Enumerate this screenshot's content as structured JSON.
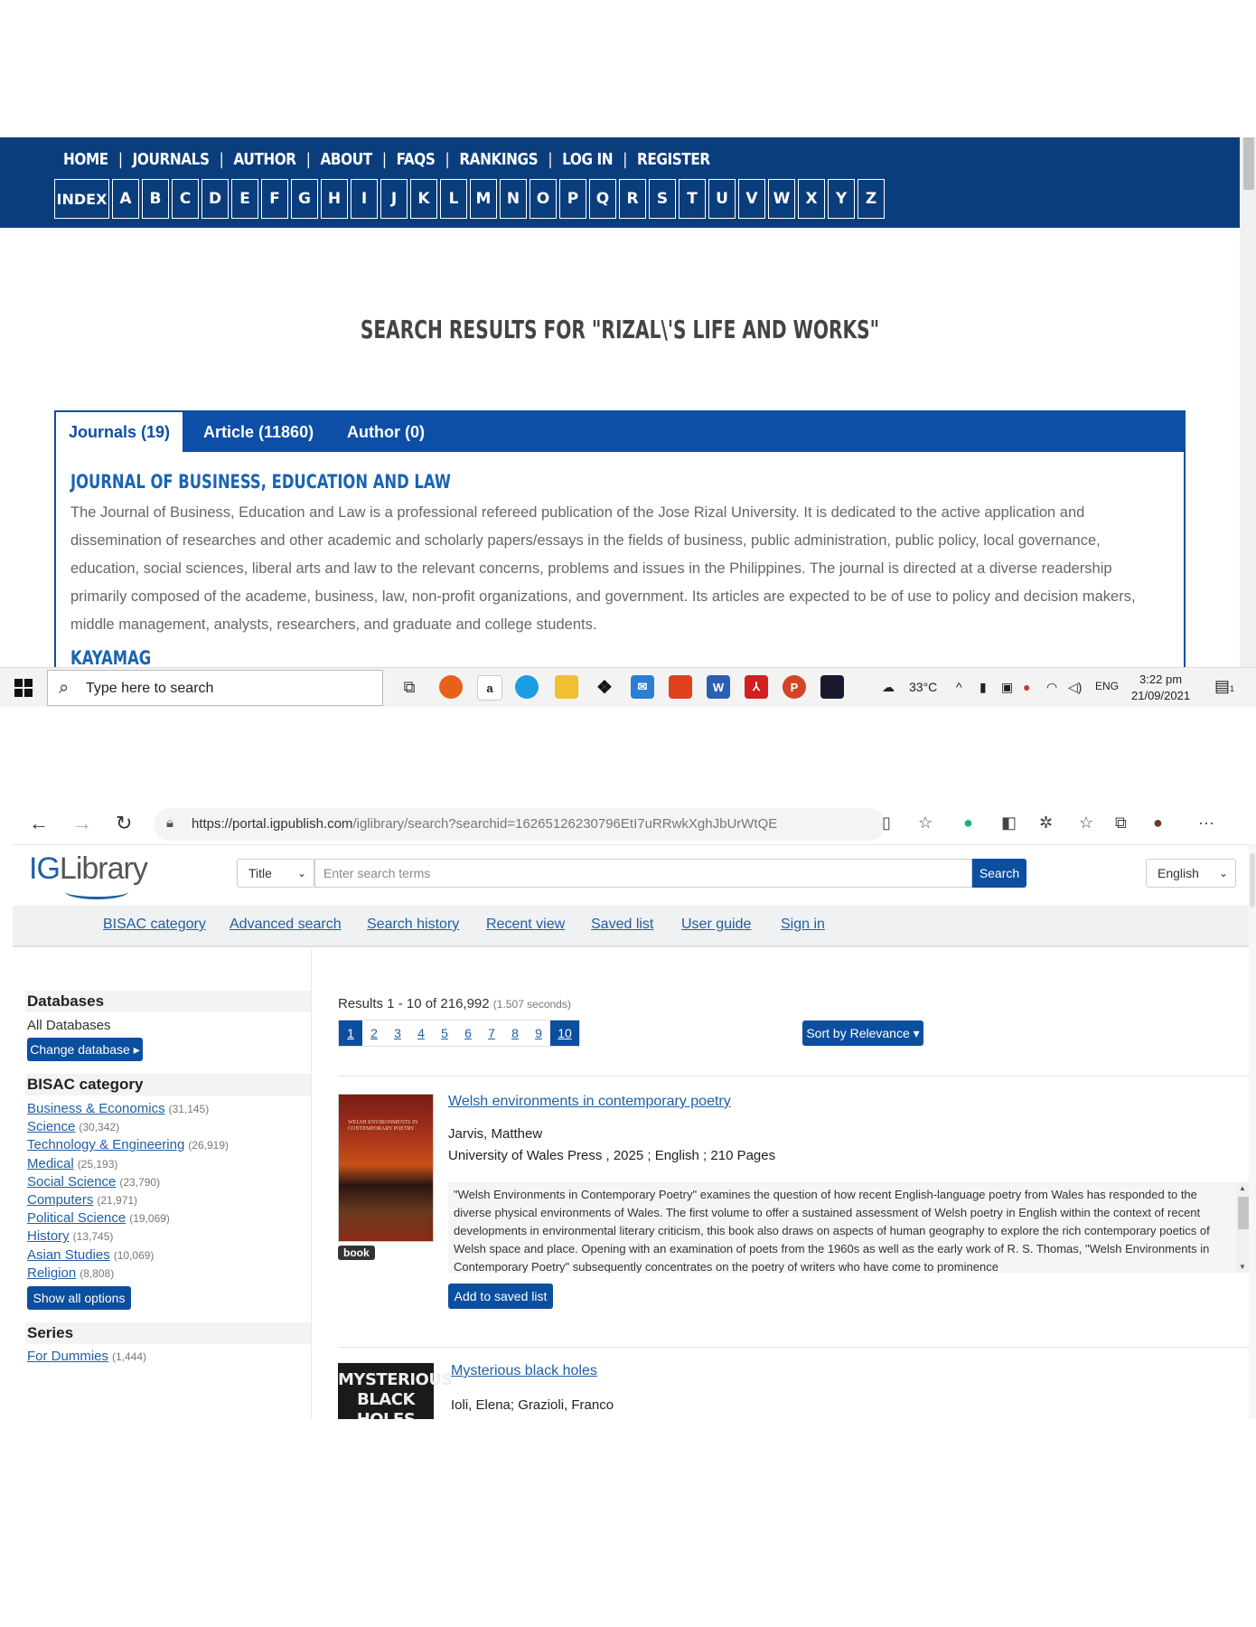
{
  "site1": {
    "menu": [
      "HOME",
      "JOURNALS",
      "AUTHOR",
      "ABOUT",
      "FAQS",
      "RANKINGS",
      "LOG IN",
      "REGISTER"
    ],
    "separator": "|",
    "index_label": "INDEX",
    "letters": [
      "A",
      "B",
      "C",
      "D",
      "E",
      "F",
      "G",
      "H",
      "I",
      "J",
      "K",
      "L",
      "M",
      "N",
      "O",
      "P",
      "Q",
      "R",
      "S",
      "T",
      "U",
      "V",
      "W",
      "X",
      "Y",
      "Z"
    ],
    "results_title": "SEARCH RESULTS FOR \"RIZAL\\'S LIFE AND WORKS\"",
    "tabs": [
      "Journals (19)",
      "Article (11860)",
      "Author (0)"
    ],
    "journal1_title": "JOURNAL OF BUSINESS, EDUCATION AND LAW",
    "journal1_desc": "The Journal of Business, Education and Law is a professional refereed publication of the Jose Rizal University. It is dedicated to the active application and dissemination of researches and other academic and scholarly papers/essays in the fields of business, public administration, public policy, local governance, education, social sciences, liberal arts and law to the relevant concerns, problems and issues in the Philippines. The journal is directed at a diverse readership primarily composed of the academe, business, law, non-profit organizations, and government. Its articles are expected to be of use to policy and decision makers, middle management, analysts, researchers, and graduate and college students.",
    "journal2_title": "KAYAMAG"
  },
  "taskbar": {
    "search_placeholder": "Type here to search",
    "temperature": "33°C",
    "lang": "ENG",
    "time": "3:22 pm",
    "date": "21/09/2021",
    "notif_count": "1"
  },
  "browser": {
    "url_host": "https://portal.igpublish.com",
    "url_path": "/iglibrary/search?searchid=16265126230796EtI7uRRwkXghJbUrWtQE"
  },
  "iglibrary": {
    "logo_ig": "IG",
    "logo_lib": "Library",
    "search_field": "Title",
    "search_placeholder": "Enter search terms",
    "search_button": "Search",
    "language": "English",
    "links": [
      "BISAC category",
      "Advanced search",
      "Search history",
      "Recent view",
      "Saved list",
      "User guide",
      "Sign in"
    ],
    "sidebar": {
      "databases_heading": "Databases",
      "databases_value": "All Databases",
      "change_db": "Change database ▸",
      "bisac_heading": "BISAC category",
      "categories": [
        {
          "name": "Business & Economics",
          "count": "(31,145)"
        },
        {
          "name": "Science",
          "count": "(30,342)"
        },
        {
          "name": "Technology & Engineering",
          "count": "(26,919)"
        },
        {
          "name": "Medical",
          "count": "(25,193)"
        },
        {
          "name": "Social Science",
          "count": "(23,790)"
        },
        {
          "name": "Computers",
          "count": "(21,971)"
        },
        {
          "name": "Political Science",
          "count": "(19,069)"
        },
        {
          "name": "History",
          "count": "(13,745)"
        },
        {
          "name": "Asian Studies",
          "count": "(10,069)"
        },
        {
          "name": "Religion",
          "count": "(8,808)"
        }
      ],
      "show_all": "Show all options",
      "series_heading": "Series",
      "series": [
        {
          "name": "For Dummies",
          "count": "(1,444)"
        }
      ]
    },
    "results_summary": "Results 1 - 10 of 216,992",
    "results_time": "(1.507 seconds)",
    "pages": [
      "1",
      "2",
      "3",
      "4",
      "5",
      "6",
      "7",
      "8",
      "9",
      "10"
    ],
    "sort_label": "Sort by Relevance ▾",
    "result1": {
      "cover_text": "WELSH ENVIRONMENTS IN CONTEMPORARY POETRY",
      "badge": "book",
      "title": "Welsh environments in contemporary poetry",
      "author": "Jarvis, Matthew",
      "publisher": "University of Wales Press , 2025 ; English ; 210 Pages",
      "abstract": "\"Welsh Environments in Contemporary Poetry\" examines the question of how recent English-language poetry from Wales has responded to the diverse physical environments of Wales. The first volume to offer a sustained assessment of Welsh poetry in English within the context of recent developments in environmental literary criticism, this book also draws on aspects of human geography to explore the rich contemporary poetics of Welsh space and place. Opening with an examination of poets from the 1960s as well as the early work of R. S. Thomas, \"Welsh Environments in Contemporary Poetry\" subsequently concentrates on the poetry of writers who have come to prominence",
      "add_button": "Add to saved list"
    },
    "result2": {
      "cover_text": "MYSTERIOUS BLACK HOLES",
      "title": "Mysterious black holes",
      "author": "Ioli, Elena; Grazioli, Franco"
    }
  }
}
